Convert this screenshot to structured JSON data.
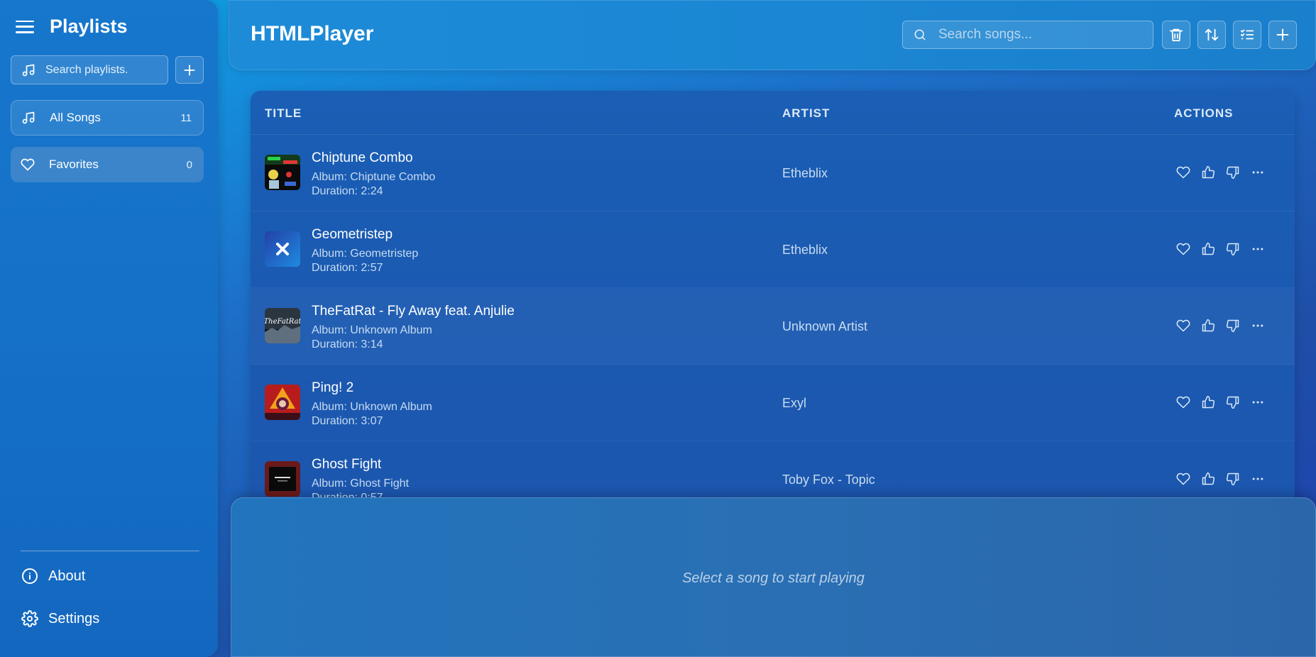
{
  "sidebar": {
    "title": "Playlists",
    "search_placeholder": "Search playlists.",
    "playlists": [
      {
        "label": "All Songs",
        "count": "11",
        "icon": "music-note-icon"
      },
      {
        "label": "Favorites",
        "count": "0",
        "icon": "heart-icon"
      }
    ],
    "about_label": "About",
    "settings_label": "Settings"
  },
  "header": {
    "app_title": "HTMLPlayer",
    "search_placeholder": "Search songs...",
    "buttons": [
      "trash-icon",
      "sort-icon",
      "list-check-icon",
      "plus-icon"
    ]
  },
  "table": {
    "columns": {
      "title": "TITLE",
      "artist": "ARTIST",
      "actions": "ACTIONS"
    },
    "rows": [
      {
        "title": "Chiptune Combo",
        "album": "Album: Chiptune Combo",
        "duration": "Duration: 2:24",
        "artist": "Etheblix"
      },
      {
        "title": "Geometristep",
        "album": "Album: Geometristep",
        "duration": "Duration: 2:57",
        "artist": "Etheblix"
      },
      {
        "title": "TheFatRat - Fly Away feat. Anjulie",
        "album": "Album: Unknown Album",
        "duration": "Duration: 3:14",
        "artist": "Unknown Artist"
      },
      {
        "title": "Ping! 2",
        "album": "Album: Unknown Album",
        "duration": "Duration: 3:07",
        "artist": "Exyl"
      },
      {
        "title": "Ghost Fight",
        "album": "Album: Ghost Fight",
        "duration": "Duration: 0:57",
        "artist": "Toby Fox - Topic"
      }
    ]
  },
  "player": {
    "message": "Select a song to start playing"
  },
  "colors": {
    "accent": "#1d8bd8",
    "sidebar": "#1677cc",
    "table": "#1a5eb5"
  }
}
